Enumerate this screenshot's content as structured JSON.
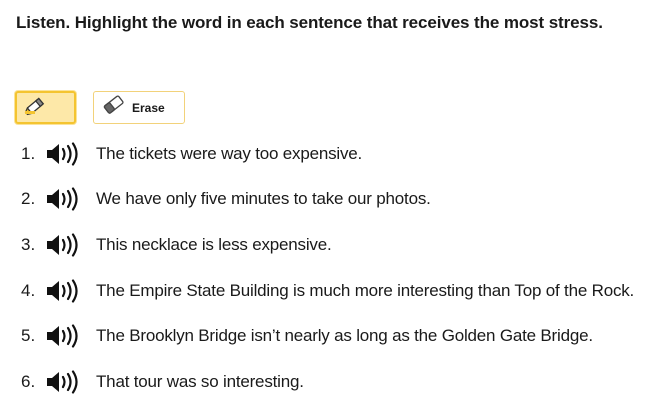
{
  "instruction": "Listen. Highlight the word in each sentence that receives the most stress.",
  "tools": {
    "highlighter_icon": "highlighter-icon",
    "eraser_icon": "eraser-icon",
    "erase_label": "Erase",
    "highlight_color": "#fde8a8",
    "accent_color": "#f4c430"
  },
  "sentences": [
    {
      "number": "1.",
      "text": "The tickets were way too expensive."
    },
    {
      "number": "2.",
      "text": "We have only five minutes to take our photos."
    },
    {
      "number": "3.",
      "text": "This necklace is less expensive."
    },
    {
      "number": "4.",
      "text": "The Empire State Building is much more interesting than Top of the Rock."
    },
    {
      "number": "5.",
      "text": "The Brooklyn Bridge isn’t nearly as long as the Golden Gate Bridge."
    },
    {
      "number": "6.",
      "text": "That tour was so interesting."
    }
  ]
}
